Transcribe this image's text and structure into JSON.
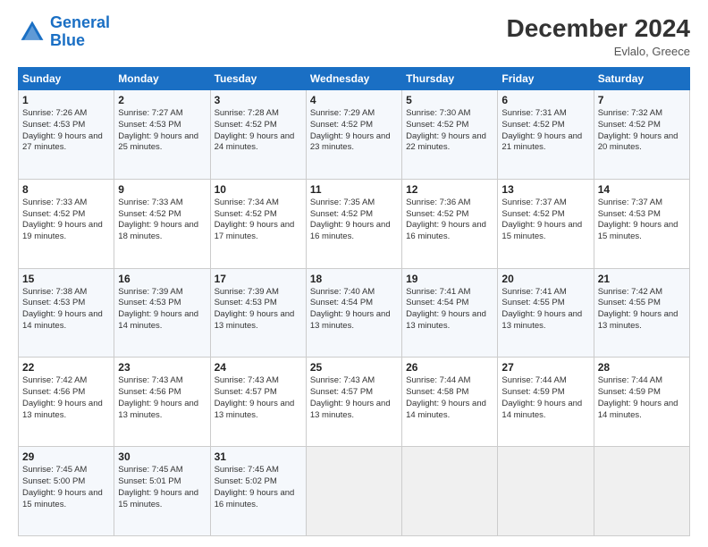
{
  "header": {
    "logo_line1": "General",
    "logo_line2": "Blue",
    "month_title": "December 2024",
    "location": "Evlalo, Greece"
  },
  "days_of_week": [
    "Sunday",
    "Monday",
    "Tuesday",
    "Wednesday",
    "Thursday",
    "Friday",
    "Saturday"
  ],
  "weeks": [
    [
      {
        "day": 1,
        "sunrise": "7:26 AM",
        "sunset": "4:53 PM",
        "daylight": "9 hours and 27 minutes."
      },
      {
        "day": 2,
        "sunrise": "7:27 AM",
        "sunset": "4:53 PM",
        "daylight": "9 hours and 25 minutes."
      },
      {
        "day": 3,
        "sunrise": "7:28 AM",
        "sunset": "4:52 PM",
        "daylight": "9 hours and 24 minutes."
      },
      {
        "day": 4,
        "sunrise": "7:29 AM",
        "sunset": "4:52 PM",
        "daylight": "9 hours and 23 minutes."
      },
      {
        "day": 5,
        "sunrise": "7:30 AM",
        "sunset": "4:52 PM",
        "daylight": "9 hours and 22 minutes."
      },
      {
        "day": 6,
        "sunrise": "7:31 AM",
        "sunset": "4:52 PM",
        "daylight": "9 hours and 21 minutes."
      },
      {
        "day": 7,
        "sunrise": "7:32 AM",
        "sunset": "4:52 PM",
        "daylight": "9 hours and 20 minutes."
      }
    ],
    [
      {
        "day": 8,
        "sunrise": "7:33 AM",
        "sunset": "4:52 PM",
        "daylight": "9 hours and 19 minutes."
      },
      {
        "day": 9,
        "sunrise": "7:33 AM",
        "sunset": "4:52 PM",
        "daylight": "9 hours and 18 minutes."
      },
      {
        "day": 10,
        "sunrise": "7:34 AM",
        "sunset": "4:52 PM",
        "daylight": "9 hours and 17 minutes."
      },
      {
        "day": 11,
        "sunrise": "7:35 AM",
        "sunset": "4:52 PM",
        "daylight": "9 hours and 16 minutes."
      },
      {
        "day": 12,
        "sunrise": "7:36 AM",
        "sunset": "4:52 PM",
        "daylight": "9 hours and 16 minutes."
      },
      {
        "day": 13,
        "sunrise": "7:37 AM",
        "sunset": "4:52 PM",
        "daylight": "9 hours and 15 minutes."
      },
      {
        "day": 14,
        "sunrise": "7:37 AM",
        "sunset": "4:53 PM",
        "daylight": "9 hours and 15 minutes."
      }
    ],
    [
      {
        "day": 15,
        "sunrise": "7:38 AM",
        "sunset": "4:53 PM",
        "daylight": "9 hours and 14 minutes."
      },
      {
        "day": 16,
        "sunrise": "7:39 AM",
        "sunset": "4:53 PM",
        "daylight": "9 hours and 14 minutes."
      },
      {
        "day": 17,
        "sunrise": "7:39 AM",
        "sunset": "4:53 PM",
        "daylight": "9 hours and 13 minutes."
      },
      {
        "day": 18,
        "sunrise": "7:40 AM",
        "sunset": "4:54 PM",
        "daylight": "9 hours and 13 minutes."
      },
      {
        "day": 19,
        "sunrise": "7:41 AM",
        "sunset": "4:54 PM",
        "daylight": "9 hours and 13 minutes."
      },
      {
        "day": 20,
        "sunrise": "7:41 AM",
        "sunset": "4:55 PM",
        "daylight": "9 hours and 13 minutes."
      },
      {
        "day": 21,
        "sunrise": "7:42 AM",
        "sunset": "4:55 PM",
        "daylight": "9 hours and 13 minutes."
      }
    ],
    [
      {
        "day": 22,
        "sunrise": "7:42 AM",
        "sunset": "4:56 PM",
        "daylight": "9 hours and 13 minutes."
      },
      {
        "day": 23,
        "sunrise": "7:43 AM",
        "sunset": "4:56 PM",
        "daylight": "9 hours and 13 minutes."
      },
      {
        "day": 24,
        "sunrise": "7:43 AM",
        "sunset": "4:57 PM",
        "daylight": "9 hours and 13 minutes."
      },
      {
        "day": 25,
        "sunrise": "7:43 AM",
        "sunset": "4:57 PM",
        "daylight": "9 hours and 13 minutes."
      },
      {
        "day": 26,
        "sunrise": "7:44 AM",
        "sunset": "4:58 PM",
        "daylight": "9 hours and 14 minutes."
      },
      {
        "day": 27,
        "sunrise": "7:44 AM",
        "sunset": "4:59 PM",
        "daylight": "9 hours and 14 minutes."
      },
      {
        "day": 28,
        "sunrise": "7:44 AM",
        "sunset": "4:59 PM",
        "daylight": "9 hours and 14 minutes."
      }
    ],
    [
      {
        "day": 29,
        "sunrise": "7:45 AM",
        "sunset": "5:00 PM",
        "daylight": "9 hours and 15 minutes."
      },
      {
        "day": 30,
        "sunrise": "7:45 AM",
        "sunset": "5:01 PM",
        "daylight": "9 hours and 15 minutes."
      },
      {
        "day": 31,
        "sunrise": "7:45 AM",
        "sunset": "5:02 PM",
        "daylight": "9 hours and 16 minutes."
      },
      null,
      null,
      null,
      null
    ]
  ]
}
